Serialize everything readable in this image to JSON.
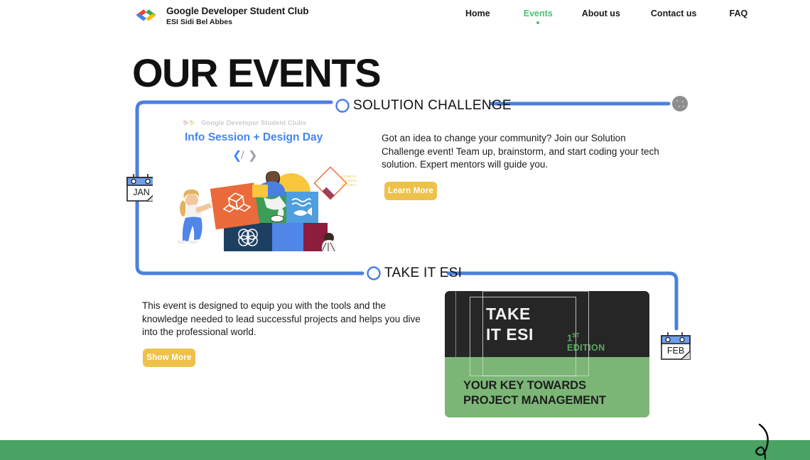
{
  "brand": {
    "logo_icon": "gdsc-chevron-logo",
    "title": "Google Developer Student Club",
    "subtitle": "ESI Sidi Bel Abbes"
  },
  "nav": {
    "items": [
      {
        "label": "Home",
        "active": false
      },
      {
        "label": "Events",
        "active": true
      },
      {
        "label": "About us",
        "active": false
      },
      {
        "label": "Contact us",
        "active": false
      },
      {
        "label": "FAQ",
        "active": false
      }
    ],
    "active_color": "#4bbf73"
  },
  "page": {
    "title": "OUR EVENTS"
  },
  "timeline": {
    "line_color": "#4a7fe0",
    "end_marker_color": "#8a8a8a",
    "sections": [
      {
        "label": "SOLUTION CHALLENGE",
        "month": "JAN"
      },
      {
        "label": "TAKE IT ESI",
        "month": "FEB"
      }
    ]
  },
  "solution_challenge": {
    "label": "SOLUTION CHALLENGE",
    "description": "Got an idea to change your community? Join our Solution Challenge event! Team up, brainstorm, and start coding your tech solution. Expert mentors will guide you.",
    "button_label": "Learn More",
    "button_color": "#eec14b",
    "month_badge": "JAN",
    "poster": {
      "brand_line": "Google Developer Student Clubs",
      "headline": "Info Session + Design Day",
      "headline_color": "#4285f4"
    }
  },
  "take_it_esi": {
    "label": "TAKE IT ESI",
    "description": "This event is designed to equip you with the tools and the knowledge needed to lead successful projects and helps you dive into the professional world.",
    "button_label": "Show More",
    "button_color": "#eec14b",
    "month_badge": "FEB",
    "poster": {
      "title_line1": "TAKE",
      "title_line2": "IT ESI",
      "edition_number": "1",
      "edition_suffix": "ST",
      "edition_word": "EDITION",
      "tagline_line1": "YOUR KEY TOWARDS",
      "tagline_line2": "PROJECT MANAGEMENT",
      "dark_color": "#262626",
      "green_color": "#7cb677",
      "accent_color": "#5aa95f"
    }
  },
  "footer": {
    "band_color": "#4aa263",
    "decoration_icon": "squiggle-curve-icon"
  }
}
